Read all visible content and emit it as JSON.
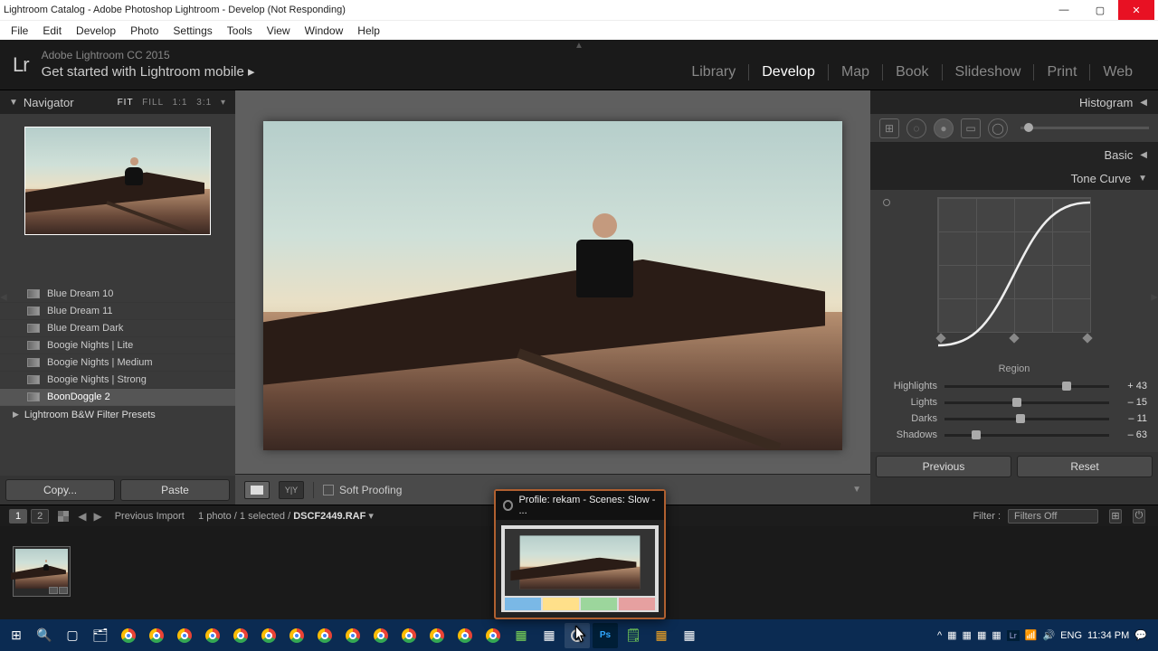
{
  "window": {
    "title": "Lightroom Catalog - Adobe Photoshop Lightroom - Develop (Not Responding)"
  },
  "menubar": [
    "File",
    "Edit",
    "Develop",
    "Photo",
    "Settings",
    "Tools",
    "View",
    "Window",
    "Help"
  ],
  "identity": {
    "line1": "Adobe Lightroom CC 2015",
    "line2": "Get started with Lightroom mobile  ▸"
  },
  "modules": [
    "Library",
    "Develop",
    "Map",
    "Book",
    "Slideshow",
    "Print",
    "Web"
  ],
  "active_module": "Develop",
  "navigator": {
    "title": "Navigator",
    "zoom_levels": [
      "FIT",
      "FILL",
      "1:1",
      "3:1"
    ],
    "zoom_active": "FIT"
  },
  "presets": {
    "items": [
      {
        "label": "Blue Dream 10"
      },
      {
        "label": "Blue Dream 11"
      },
      {
        "label": "Blue Dream Dark"
      },
      {
        "label": "Boogie Nights | Lite"
      },
      {
        "label": "Boogie Nights | Medium"
      },
      {
        "label": "Boogie Nights | Strong"
      },
      {
        "label": "BoonDoggle 2",
        "selected": true
      }
    ],
    "folder": "Lightroom B&W Filter Presets"
  },
  "left_buttons": {
    "copy": "Copy...",
    "paste": "Paste"
  },
  "toolbar": {
    "soft_proofing": "Soft Proofing"
  },
  "right_panels": {
    "histogram": "Histogram",
    "basic": "Basic",
    "tone_curve": "Tone Curve",
    "region_title": "Region",
    "sliders": [
      {
        "name": "Highlights",
        "value": "+ 43",
        "pos": 74
      },
      {
        "name": "Lights",
        "value": "– 15",
        "pos": 44
      },
      {
        "name": "Darks",
        "value": "– 11",
        "pos": 46
      },
      {
        "name": "Shadows",
        "value": "– 63",
        "pos": 19
      }
    ]
  },
  "right_buttons": {
    "previous": "Previous",
    "reset": "Reset"
  },
  "filmstrip_bar": {
    "secondary_labels": [
      "1",
      "2"
    ],
    "crumb_prefix": "Previous Import",
    "crumb_count": "1 photo / 1 selected /",
    "crumb_file": "DSCF2449.RAF",
    "filter_label": "Filter :",
    "filter_value": "Filters Off"
  },
  "hover_popup": {
    "title": "Profile: rekam - Scenes: Slow - ..."
  },
  "tray": {
    "lang": "ENG",
    "time": "11:34 PM"
  }
}
